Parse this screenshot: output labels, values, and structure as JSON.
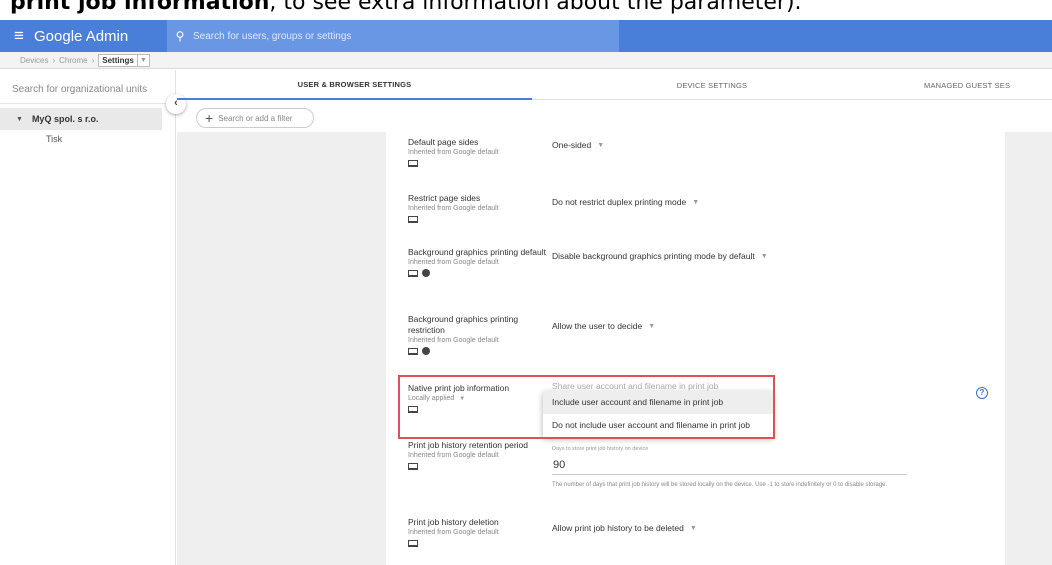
{
  "caption": {
    "bold": "print job information",
    "rest": ", to see extra information about the parameter)."
  },
  "topbar": {
    "menu_glyph": "≡",
    "brand": "Google Admin",
    "search_placeholder": "Search for users, groups or settings"
  },
  "breadcrumb": {
    "items": [
      "Devices",
      "Chrome",
      "Settings"
    ]
  },
  "sidebar": {
    "search_label": "Search for organizational units",
    "org_name": "MyQ spol. s r.o.",
    "sub_unit": "Tisk",
    "collapse_glyph": "‹"
  },
  "tabs": [
    {
      "label": "USER & BROWSER SETTINGS",
      "active": true
    },
    {
      "label": "DEVICE SETTINGS",
      "active": false
    },
    {
      "label": "MANAGED GUEST SES",
      "active": false
    }
  ],
  "filter": {
    "label": "Search or add a filter"
  },
  "settings": [
    {
      "name": "Default page sides",
      "source": "Inherited from Google default",
      "value": "One-sided",
      "globe": false
    },
    {
      "name": "Restrict page sides",
      "source": "Inherited from Google default",
      "value": "Do not restrict duplex printing mode",
      "globe": false
    },
    {
      "name": "Background graphics printing default",
      "source": "Inherited from Google default",
      "value": "Disable background graphics printing mode by default",
      "globe": true
    },
    {
      "name": "Background graphics printing restriction",
      "source": "Inherited from Google default",
      "value": "Allow the user to decide",
      "globe": true
    },
    {
      "name": "Native print job information",
      "source": "Locally applied",
      "value": "Share user account and filename in print job",
      "globe": false
    },
    {
      "name": "Print job history retention period",
      "source": "Inherited from Google default",
      "value": "",
      "globe": false
    },
    {
      "name": "Print job history deletion",
      "source": "Inherited from Google default",
      "value": "Allow print job history to be deleted",
      "globe": false
    }
  ],
  "dropdown": {
    "options": [
      "Include user account and filename in print job",
      "Do not include user account and filename in print job"
    ],
    "hovered_index": 0
  },
  "retention": {
    "label": "Days to store print job history on device",
    "value": "90",
    "help": "The number of days that print job history will be stored locally on the device. Use -1 to store indefinitely or 0 to disable storage."
  },
  "help_glyph": "?",
  "colors": {
    "topbar": "#4a7fd9",
    "highlight": "#e05058",
    "accent": "#3c6fd0"
  }
}
